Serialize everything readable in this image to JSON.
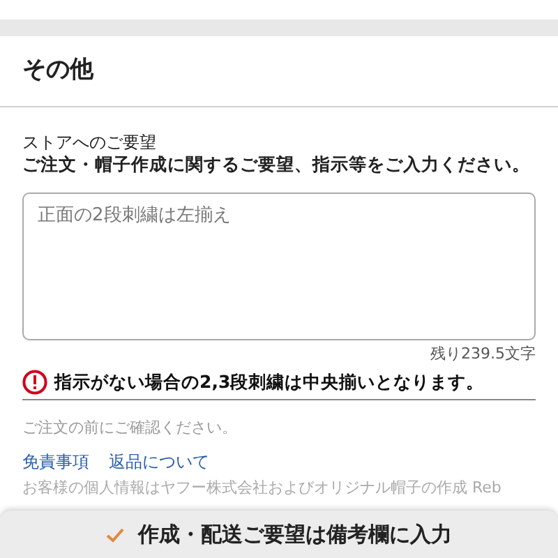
{
  "section": {
    "title": "その他"
  },
  "request": {
    "label": "ストアへのご要望",
    "instruction": "ご注文・帽子作成に関するご要望、指示等をご入力ください。",
    "placeholder": "正面の2段刺繍は左揃え",
    "counter": "残り239.5文字",
    "warning": "指示がない場合の2,3段刺繍は中央揃いとなります。"
  },
  "footer": {
    "note": "ご注文の前にご確認ください。",
    "links": [
      "免責事項",
      "返品について"
    ],
    "privacy": "お客様の個人情報はヤフー株式会社およびオリジナル帽子の作成 Reb"
  },
  "banner": {
    "text": "作成・配送ご要望は備考欄に入力"
  }
}
